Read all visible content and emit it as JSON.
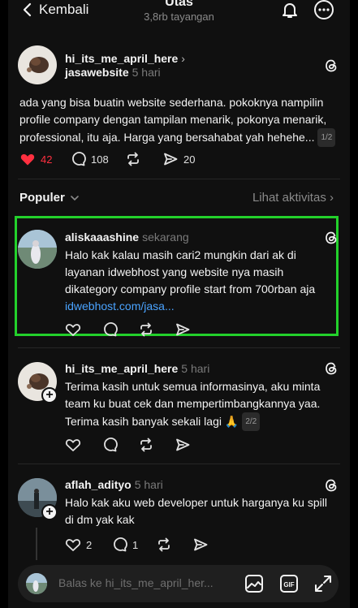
{
  "header": {
    "back_label": "Kembali",
    "title": "Utas",
    "views": "3,8rb tayangan"
  },
  "main_post": {
    "username": "hi_its_me_april_here",
    "chevron": "›",
    "reply_to": "jasawebsite",
    "time": "5 hari",
    "text": "ada yang bisa buatin website sederhana. pokoknya nampilin profile company dengan tampilan menarik, pokonya menarik, professional, itu aja. Harga yang bersahabat yah hehehe...",
    "page": "1/2",
    "likes": "42",
    "comments": "108",
    "shares": "20",
    "like_color": "#ff3040"
  },
  "popular": {
    "label": "Populer",
    "activity": "Lihat aktivitas",
    "activity_chevron": "›"
  },
  "replies": [
    {
      "username": "aliskaaashine",
      "time": "sekarang",
      "text": "Halo kak kalau masih cari2 mungkin dari ak di layanan idwebhost yang website nya masih dikategory company profile start from 700rban aja",
      "link": "idwebhost.com/jasa..."
    },
    {
      "username": "hi_its_me_april_here",
      "time": "5 hari",
      "text": "Terima kasih untuk semua informasinya, aku minta team ku buat cek dan mempertimbangkannya yaa. Terima kasih banyak sekali lagi 🙏",
      "page": "2/2"
    },
    {
      "username": "aflah_adityo",
      "time": "5 hari",
      "text": "Halo kak aku web developer untuk harganya ku spill di dm yak kak",
      "likes": "2",
      "comments": "1"
    }
  ],
  "composer": {
    "placeholder": "Balas ke hi_its_me_april_her..."
  },
  "colors": {
    "highlight": "#23d12b",
    "link": "#4aa3ff"
  }
}
